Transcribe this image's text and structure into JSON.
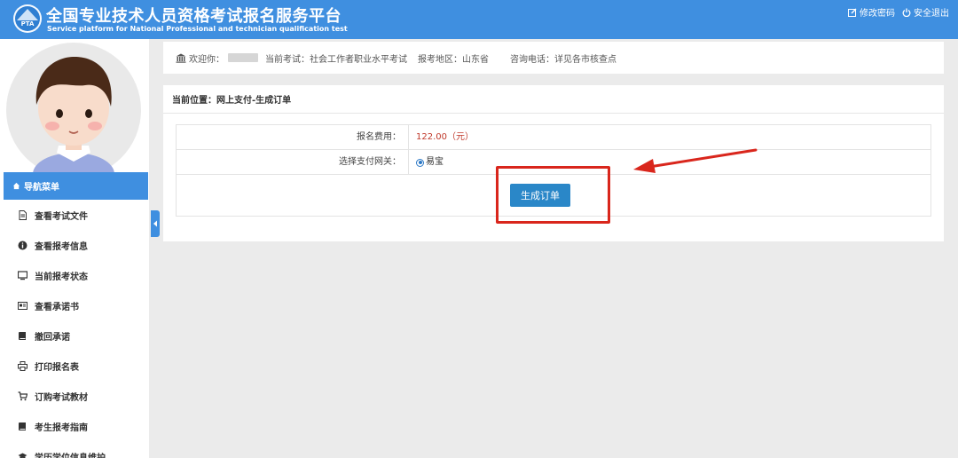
{
  "header": {
    "title_cn": "全国专业技术人员资格考试报名服务平台",
    "title_en": "Service platform for National Professional and technician qualification test",
    "logo_text": "PTA",
    "links": {
      "change_password": "修改密码",
      "logout": "安全退出"
    }
  },
  "sidebar": {
    "nav_title": "导航菜单",
    "items": [
      {
        "label": "查看考试文件",
        "icon": "file-icon"
      },
      {
        "label": "查看报考信息",
        "icon": "info-icon"
      },
      {
        "label": "当前报考状态",
        "icon": "monitor-icon"
      },
      {
        "label": "查看承诺书",
        "icon": "card-icon"
      },
      {
        "label": "撤回承诺",
        "icon": "book-icon"
      },
      {
        "label": "打印报名表",
        "icon": "print-icon"
      },
      {
        "label": "订购考试教材",
        "icon": "cart-icon"
      },
      {
        "label": "考生报考指南",
        "icon": "book-icon"
      },
      {
        "label": "学历学位信息维护",
        "icon": "graduation-cap-icon"
      }
    ]
  },
  "welcome": {
    "greeting": "欢迎你：",
    "exam": "当前考试：社会工作者职业水平考试",
    "region": "报考地区：山东省",
    "phone": "咨询电话：详见各市核查点"
  },
  "panel": {
    "location": "当前位置：网上支付-生成订单",
    "fee_label": "报名费用：",
    "fee_value": "122.00（元）",
    "gateway_label": "选择支付网关：",
    "gateway_option": "易宝",
    "submit_label": "生成订单"
  },
  "colors": {
    "brand_blue": "#3f8fe0",
    "button_blue": "#2a87c8",
    "annotation_red": "#d9261c",
    "fee_red": "#c0392b"
  }
}
